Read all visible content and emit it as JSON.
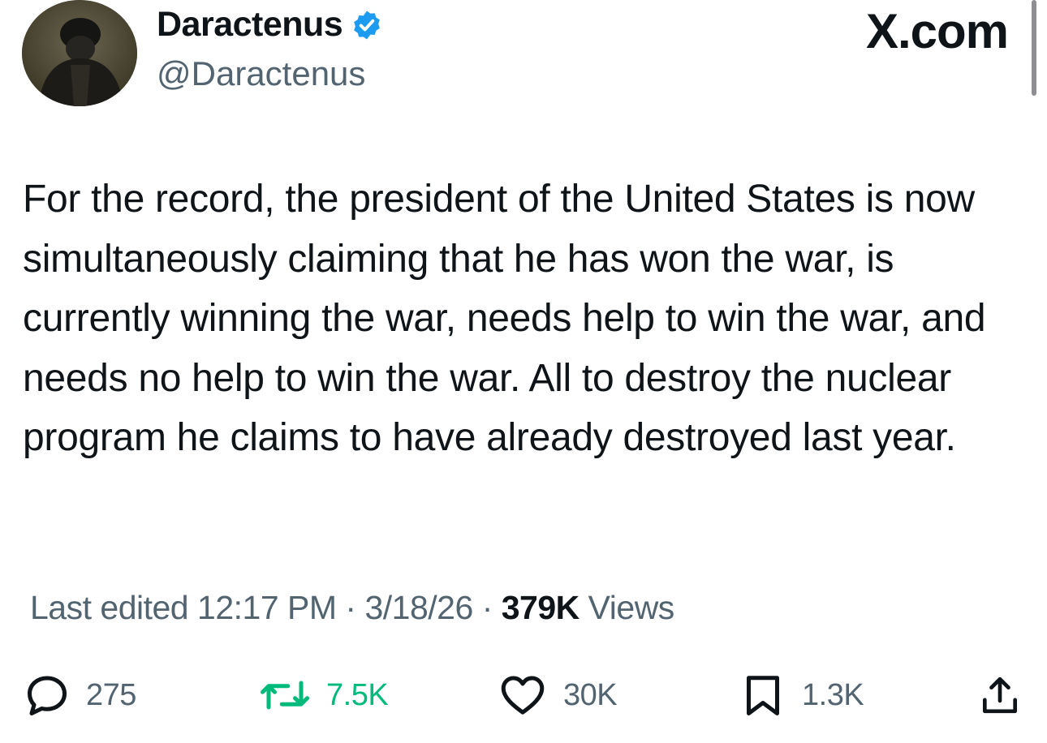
{
  "header": {
    "display_name": "Daractenus",
    "handle": "@Daractenus",
    "brand": "X.com",
    "verified_icon": "verified-badge-icon",
    "accent_color": "#1d9bf0"
  },
  "tweet": {
    "text": "For the record, the president of the United States is now simultaneously claiming that he has won the war, is currently winning the war, needs help to win the war, and needs no help to win the war. All to destroy the nuclear program he claims to have already destroyed last year."
  },
  "meta": {
    "edited_prefix": "Last edited",
    "time": "12:17 PM",
    "date": "3/18/26",
    "separator": "·",
    "views_count": "379K",
    "views_label": "Views"
  },
  "actions": {
    "replies": {
      "icon": "reply-icon",
      "count": "275"
    },
    "retweets": {
      "icon": "retweet-icon",
      "count": "7.5K",
      "color": "#00ba7c"
    },
    "likes": {
      "icon": "heart-icon",
      "count": "30K"
    },
    "bookmarks": {
      "icon": "bookmark-icon",
      "count": "1.3K"
    },
    "share": {
      "icon": "share-icon"
    }
  }
}
